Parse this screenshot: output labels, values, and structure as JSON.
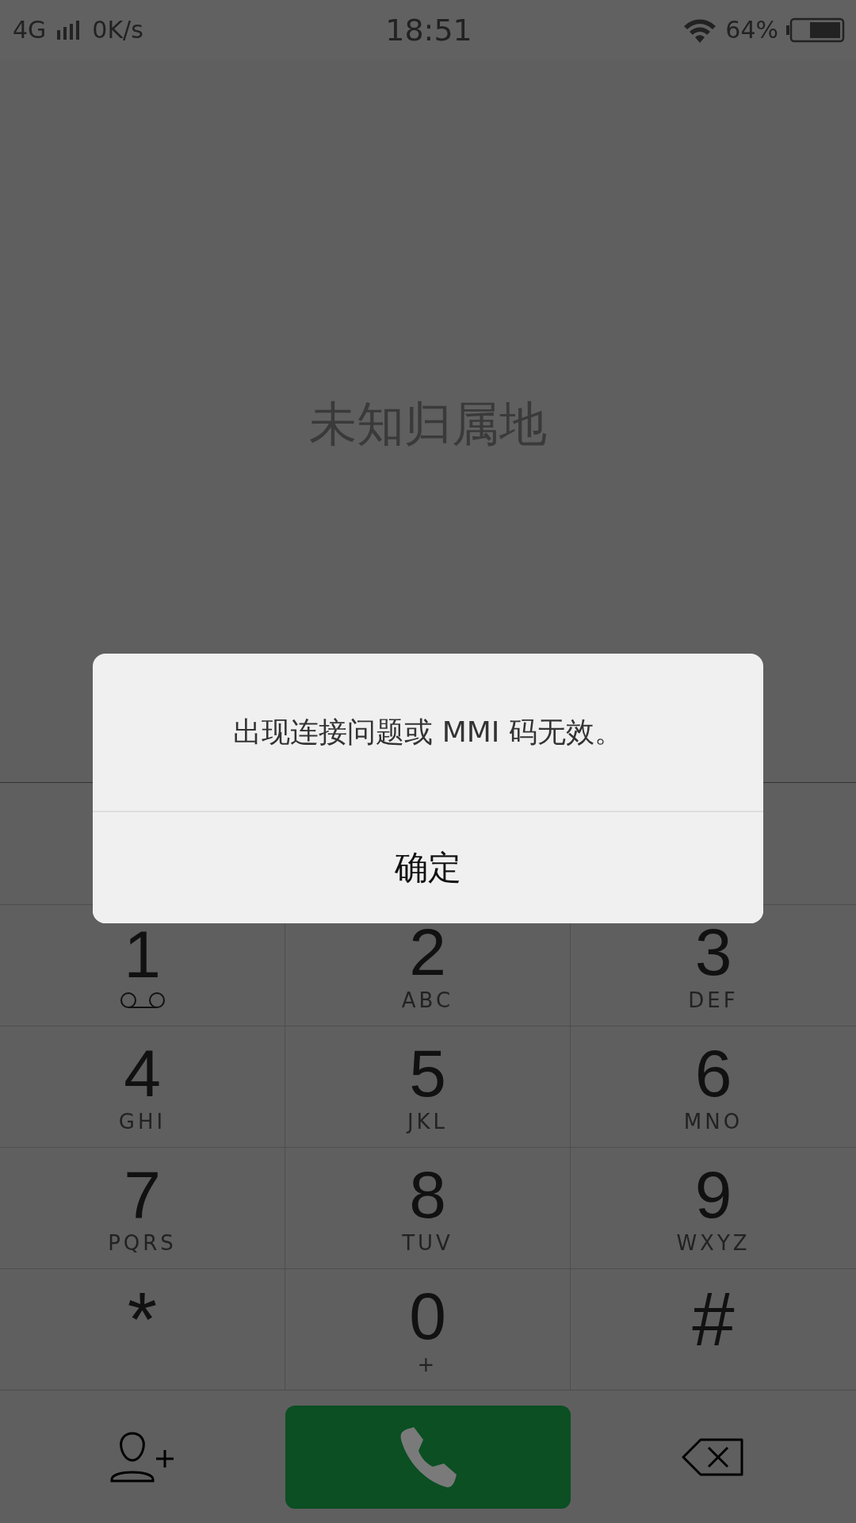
{
  "status_bar": {
    "network": "4G",
    "speed": "0K/s",
    "time": "18:51",
    "battery": "64%"
  },
  "location": "未知归属地",
  "keypad": [
    {
      "digit": "1",
      "kind": "voicemail"
    },
    {
      "digit": "2",
      "letters": "ABC",
      "kind": "letters"
    },
    {
      "digit": "3",
      "letters": "DEF",
      "kind": "letters"
    },
    {
      "digit": "4",
      "letters": "GHI",
      "kind": "letters"
    },
    {
      "digit": "5",
      "letters": "JKL",
      "kind": "letters"
    },
    {
      "digit": "6",
      "letters": "MNO",
      "kind": "letters"
    },
    {
      "digit": "7",
      "letters": "PQRS",
      "kind": "letters"
    },
    {
      "digit": "8",
      "letters": "TUV",
      "kind": "letters"
    },
    {
      "digit": "9",
      "letters": "WXYZ",
      "kind": "letters"
    },
    {
      "digit": "*",
      "kind": "symbol"
    },
    {
      "digit": "0",
      "letters": "+",
      "kind": "letters"
    },
    {
      "digit": "#",
      "kind": "symbol"
    }
  ],
  "dialog": {
    "message": "出现连接问题或 MMI 码无效。",
    "button": "确定"
  }
}
